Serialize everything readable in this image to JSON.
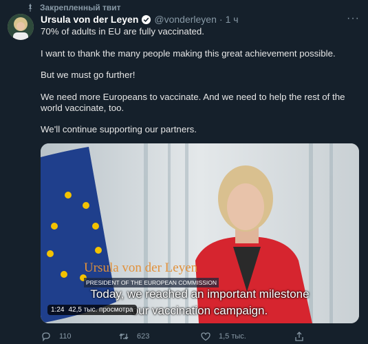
{
  "pinned_label": "Закрепленный твит",
  "author": {
    "name": "Ursula von der Leyen",
    "handle": "@vonderleyen",
    "separator": "·",
    "time": "1 ч"
  },
  "tweet": {
    "paragraphs": [
      "70% of adults in EU are fully vaccinated.",
      "I want to thank the many people making this great achievement possible.",
      "But we must go further!",
      "We need more Europeans to vaccinate. And we need to help the rest of the world vaccinate, too.",
      "We'll continue supporting our partners."
    ]
  },
  "video": {
    "lower_third_name": "Ursula von der Leyen",
    "lower_third_title": "PRESIDENT OF THE EUROPEAN COMMISSION",
    "subtitle_line1": "Today, we reached an important milestone",
    "subtitle_line2": "our vaccination campaign.",
    "duration": "1:24",
    "views": "42,5 тыс. просмотра"
  },
  "actions": {
    "reply_count": "110",
    "retweet_count": "623",
    "like_count": "1,5 тыс.",
    "share_count": ""
  },
  "colors": {
    "background": "#15202b",
    "muted": "#8899a6",
    "text": "#e6e6e6",
    "verified": "#ffffff"
  },
  "icons": [
    "pin-icon",
    "verified-icon",
    "more-icon",
    "reply-icon",
    "retweet-icon",
    "like-icon",
    "share-icon"
  ]
}
